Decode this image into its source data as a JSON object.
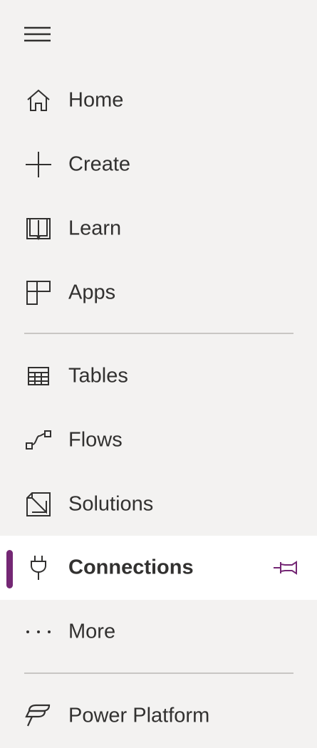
{
  "nav": {
    "menu_icon": "hamburger-icon",
    "items": [
      {
        "label": "Home",
        "icon": "home-icon"
      },
      {
        "label": "Create",
        "icon": "plus-icon"
      },
      {
        "label": "Learn",
        "icon": "book-icon"
      },
      {
        "label": "Apps",
        "icon": "apps-icon"
      },
      {
        "label": "Tables",
        "icon": "table-icon"
      },
      {
        "label": "Flows",
        "icon": "flow-icon"
      },
      {
        "label": "Solutions",
        "icon": "solutions-icon"
      },
      {
        "label": "Connections",
        "icon": "plug-icon",
        "selected": true,
        "pinned": true
      },
      {
        "label": "More",
        "icon": "more-icon"
      },
      {
        "label": "Power Platform",
        "icon": "power-platform-icon"
      }
    ]
  },
  "colors": {
    "background": "#f3f2f1",
    "selected_background": "#ffffff",
    "accent": "#742774",
    "text": "#323130",
    "divider": "#c8c6c4"
  }
}
